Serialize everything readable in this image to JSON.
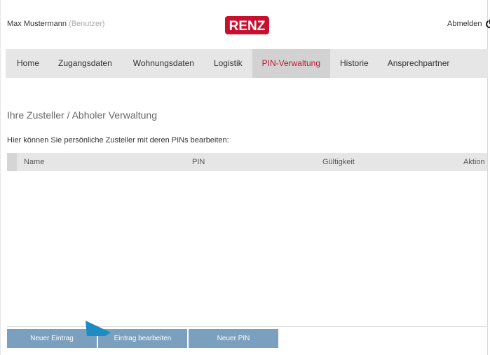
{
  "header": {
    "user_name": "Max Mustermann",
    "user_role": "(Benutzer)",
    "logo_text": "RENZ",
    "logout_label": "Abmelden",
    "brand_color": "#c8102e"
  },
  "nav": {
    "items": [
      {
        "label": "Home"
      },
      {
        "label": "Zugangsdaten"
      },
      {
        "label": "Wohnungsdaten"
      },
      {
        "label": "Logistik"
      },
      {
        "label": "PIN-Verwaltung",
        "active": true
      },
      {
        "label": "Historie"
      },
      {
        "label": "Ansprechpartner"
      }
    ]
  },
  "main": {
    "title": "Ihre Zusteller / Abholer Verwaltung",
    "subtitle": "Hier können Sie persönliche Zusteller mit deren PINs bearbeiten:",
    "table": {
      "columns": [
        "Name",
        "PIN",
        "Gültigkeit",
        "Aktion"
      ],
      "rows": []
    }
  },
  "actions": {
    "new_entry": "Neuer Eintrag",
    "edit_entry": "Eintrag bearbeiten",
    "new_pin": "Neuer PIN",
    "button_color": "#7a9fbf"
  },
  "icons": {
    "logout": "power-icon",
    "pointer": "mouse-pointer-icon"
  }
}
